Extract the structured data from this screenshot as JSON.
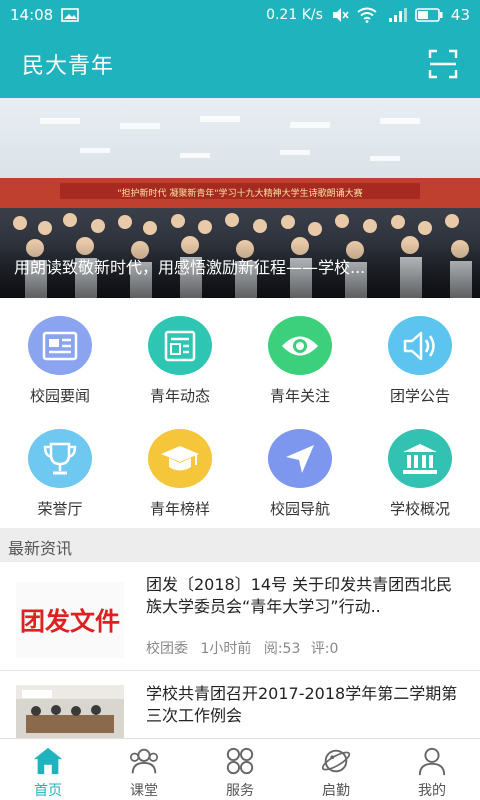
{
  "status": {
    "time": "14:08",
    "speed": "0.21 K/s",
    "battery": "43"
  },
  "appbar": {
    "title": "民大青年"
  },
  "banner": {
    "caption": "用朗读致敬新时代，用感悟激励新征程——学校...",
    "stage_text": "\"担护新时代 凝聚新青年\"学习十九大精神大学生诗歌朗诵大赛"
  },
  "grid": [
    {
      "label": "校园要闻",
      "icon": "newspaper-icon",
      "color": "#8aa4f0"
    },
    {
      "label": "青年动态",
      "icon": "news-card-icon",
      "color": "#2ec6b2"
    },
    {
      "label": "青年关注",
      "icon": "eye-icon",
      "color": "#3dd07c"
    },
    {
      "label": "团学公告",
      "icon": "speaker-icon",
      "color": "#5cc4ee"
    },
    {
      "label": "荣誉厅",
      "icon": "trophy-icon",
      "color": "#6fc8ef"
    },
    {
      "label": "青年榜样",
      "icon": "graduation-cap-icon",
      "color": "#f5c53a"
    },
    {
      "label": "校园导航",
      "icon": "navigation-icon",
      "color": "#7d97ef"
    },
    {
      "label": "学校概况",
      "icon": "institution-icon",
      "color": "#33c1b1"
    }
  ],
  "section": {
    "title": "最新资讯"
  },
  "news": [
    {
      "thumb_text": "团发文件",
      "title": "团发〔2018〕14号 关于印发共青团西北民族大学委员会“青年大学习”行动..",
      "source": "校团委",
      "time": "1小时前",
      "reads": "阅:53",
      "comments": "评:0"
    },
    {
      "title": "学校共青团召开2017-2018学年第二学期第三次工作例会"
    }
  ],
  "tabs": [
    {
      "label": "首页",
      "icon": "home-icon",
      "active": true
    },
    {
      "label": "课堂",
      "icon": "people-icon",
      "active": false
    },
    {
      "label": "服务",
      "icon": "services-icon",
      "active": false
    },
    {
      "label": "启勤",
      "icon": "planet-icon",
      "active": false
    },
    {
      "label": "我的",
      "icon": "user-icon",
      "active": false
    }
  ],
  "colors": {
    "primary": "#1fb3bd",
    "thumb_text": "#e02020"
  }
}
